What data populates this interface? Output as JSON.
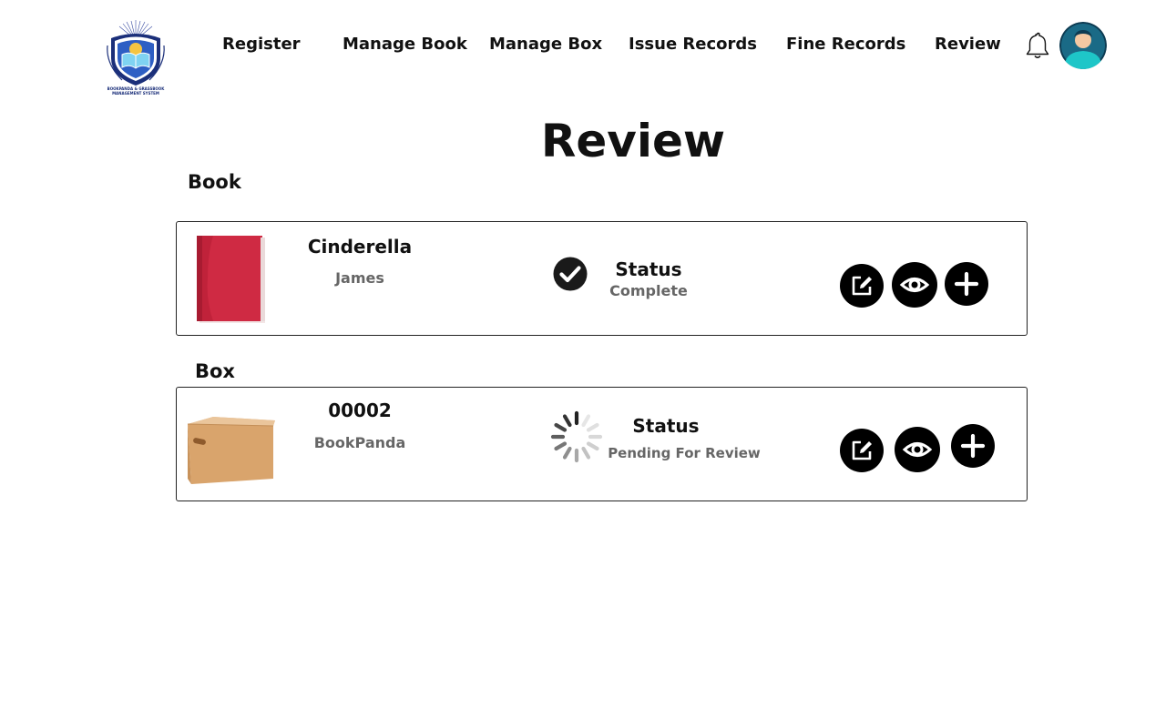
{
  "header": {
    "logo": {
      "icon": "shield-book-logo",
      "caption_line1": "BOOKPANDA & GRASSBOOK",
      "caption_line2": "MANAGEMENT SYSTEM"
    },
    "nav": [
      {
        "label": "Register"
      },
      {
        "label": "Manage Book"
      },
      {
        "label": "Manage Box"
      },
      {
        "label": "Issue Records"
      },
      {
        "label": "Fine Records"
      },
      {
        "label": "Review"
      }
    ],
    "notification_icon": "bell-icon",
    "avatar_icon": "user-avatar"
  },
  "page": {
    "title": "Review"
  },
  "sections": {
    "book": {
      "title": "Book",
      "item": {
        "thumbnail": "red-book-image",
        "name": "Cinderella",
        "subtitle": "James",
        "status_icon": "check-circle-icon",
        "status_label": "Status",
        "status_value": "Complete"
      }
    },
    "box": {
      "title": "Box",
      "item": {
        "thumbnail": "cardboard-box-image",
        "name": "00002",
        "subtitle": "BookPanda",
        "status_icon": "loading-spinner-icon",
        "status_label": "Status",
        "status_value": "Pending For Review"
      }
    }
  },
  "actions": {
    "edit_icon": "edit-icon",
    "view_icon": "eye-icon",
    "add_icon": "plus-icon"
  },
  "colors": {
    "accent": "#000000",
    "muted_text": "#666666",
    "book_red": "#c0223a",
    "box_tan": "#d4a26a",
    "avatar_teal": "#1ec6c8",
    "logo_blue": "#1b2f7a"
  }
}
